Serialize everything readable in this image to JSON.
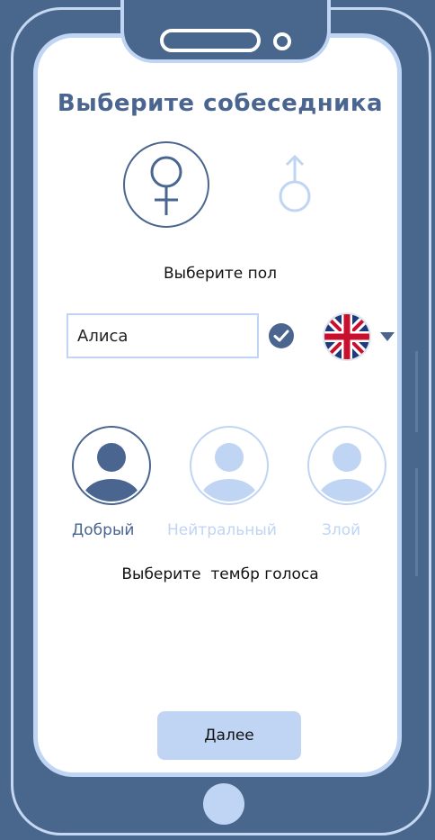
{
  "screen": {
    "title": "Выберите собеседника",
    "gender_caption": "Выберите пол",
    "name_input": {
      "value": "Алиса",
      "placeholder": ""
    },
    "language": {
      "flag_icon": "uk-flag-icon",
      "dropdown_icon": "chevron-down-icon"
    },
    "voices": [
      {
        "label": "Добрый",
        "selected": true
      },
      {
        "label": "Нейтральный",
        "selected": false
      },
      {
        "label": "Злой",
        "selected": false
      }
    ],
    "voice_caption": "Выберите  тембр голоса",
    "next_button": "Далее"
  },
  "colors": {
    "frame": "#49668c",
    "accent": "#4a6690",
    "light": "#bfd5f3",
    "screen_bg": "#ffffff"
  },
  "icons": {
    "female": "female-symbol-icon",
    "male": "male-symbol-icon",
    "check": "check-circle-icon",
    "avatar": "user-avatar-icon"
  }
}
